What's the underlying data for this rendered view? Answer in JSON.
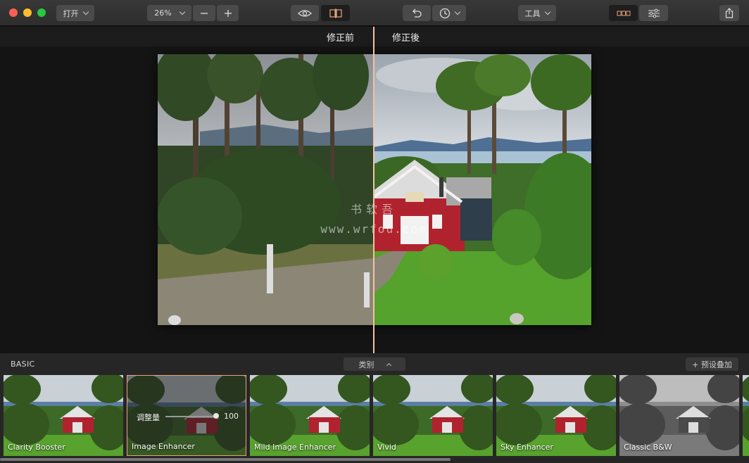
{
  "toolbar": {
    "open_label": "打开",
    "zoom_value": "26%",
    "tools_label": "工具"
  },
  "compare": {
    "before_label": "修正前",
    "after_label": "修正後"
  },
  "panel": {
    "category_header": "BASIC",
    "category_dropdown": "类别",
    "add_preset_label": "+ 预设叠加",
    "presets": [
      {
        "name": "Clarity Booster"
      },
      {
        "name": "Image Enhancer",
        "amount_label": "调整量",
        "amount_value": "100"
      },
      {
        "name": "Mild Image Enhancer"
      },
      {
        "name": "Vivid"
      },
      {
        "name": "Sky Enhancer"
      },
      {
        "name": "Classic B&W"
      }
    ]
  },
  "watermark": {
    "line1": "书软吾",
    "line2": "www.wrfou.com"
  },
  "colors": {
    "accent": "#e9a477",
    "divider": "#f4c3a4",
    "house_red": "#b0232e"
  },
  "icons": [
    "eye-icon",
    "split-compare-icon",
    "undo-icon",
    "history-icon",
    "filmstrip-icon",
    "sliders-icon",
    "share-icon"
  ]
}
